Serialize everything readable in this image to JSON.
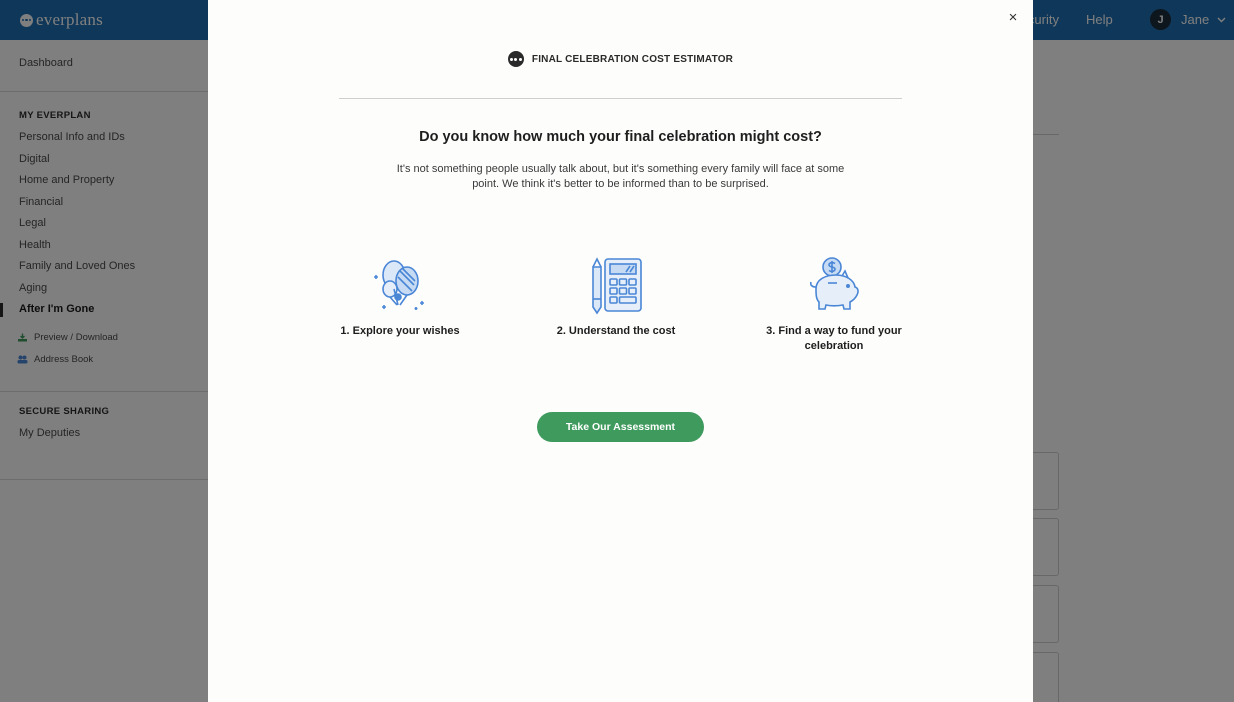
{
  "app": {
    "brand": "everplans",
    "nav": {
      "security": "Security",
      "help": "Help"
    },
    "user": {
      "initial": "J",
      "name": "Jane"
    }
  },
  "sidebar": {
    "dashboard": "Dashboard",
    "my_everplan_heading": "MY EVERPLAN",
    "items": [
      "Personal Info and IDs",
      "Digital",
      "Home and Property",
      "Financial",
      "Legal",
      "Health",
      "Family and Loved Ones",
      "Aging",
      "After I'm Gone"
    ],
    "active_item": "After I'm Gone",
    "tools": [
      "Preview / Download",
      "Address Book"
    ],
    "secure_sharing_heading": "SECURE SHARING",
    "deputies": "My Deputies"
  },
  "modal": {
    "close_label": "×",
    "header": "FINAL CELEBRATION COST ESTIMATOR",
    "question": "Do you know how much your final celebration might cost?",
    "description": "It's not something people usually talk about, but it's something every family will face at some point. We think it's better to be informed than to be surprised.",
    "steps": [
      {
        "label": "1. Explore your wishes",
        "icon": "balloons-icon"
      },
      {
        "label": "2. Understand the cost",
        "icon": "calculator-icon"
      },
      {
        "label": "3. Find a way to fund your celebration",
        "icon": "piggy-bank-icon"
      }
    ],
    "cta": "Take Our Assessment"
  },
  "colors": {
    "topbar": "#1f6fb2",
    "cta": "#3f9a5d",
    "icon_blue": "#4a86d6"
  }
}
